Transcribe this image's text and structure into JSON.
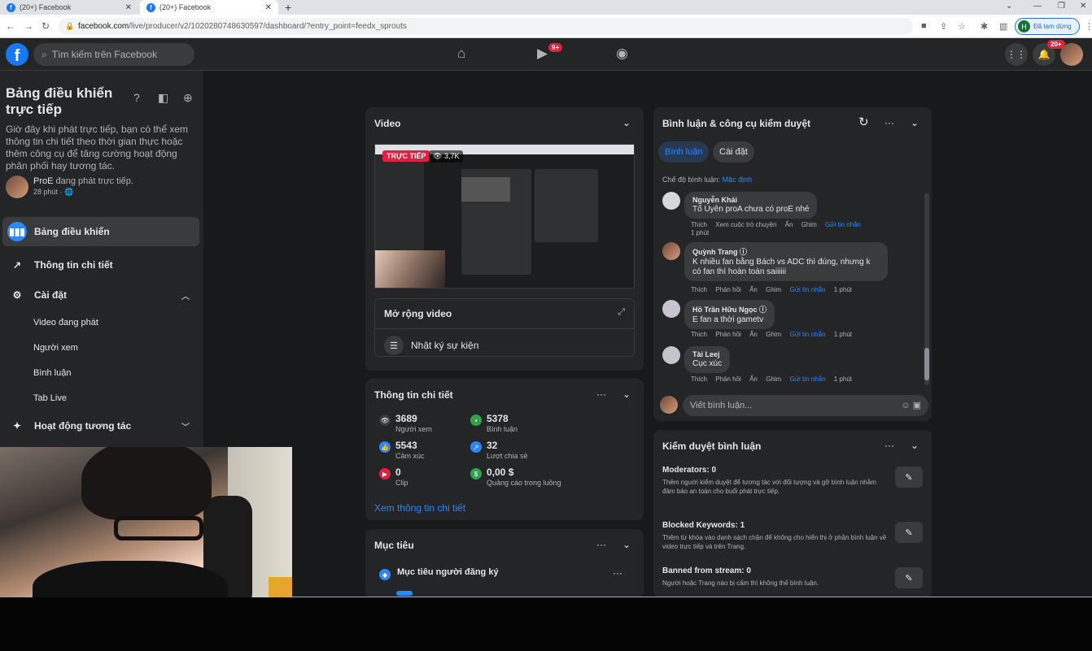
{
  "browser": {
    "tabs": [
      {
        "title": "(20+) Facebook"
      },
      {
        "title": "(20+) Facebook"
      }
    ],
    "url_host": "facebook.com",
    "url_path": "/live/producer/v2/1020280748630597/dashboard/?entry_point=feedx_sprouts",
    "profile_initial": "H",
    "profile_label": "Đã tạm dừng"
  },
  "topbar": {
    "search_placeholder": "Tìm kiếm trên Facebook",
    "video_badge": "9+",
    "notif_badge": "20+"
  },
  "sidebar": {
    "title": "Bảng điều khiển trực tiếp",
    "description": "Giờ đây khi phát trực tiếp, bạn có thể xem thông tin chi tiết theo thời gian thực hoặc thêm công cụ để tăng cường hoạt động phân phối hay tương tác.",
    "live_user_name": "ProE",
    "live_user_status": " đang phát trực tiếp.",
    "live_user_time": "28 phút · 🌐",
    "menu": [
      {
        "label": "Bảng điều khiển"
      },
      {
        "label": "Thông tin chi tiết"
      },
      {
        "label": "Cài đặt"
      },
      {
        "label": "Hoạt động tương tác"
      }
    ],
    "submenu": [
      "Video đang phát",
      "Người xem",
      "Bình luận",
      "Tab Live"
    ]
  },
  "video_card": {
    "title": "Video",
    "live_badge": "TRỰC TIẾP",
    "views": "3,7K",
    "expand_label": "Mở rộng video",
    "event_log_label": "Nhật ký sự kiện"
  },
  "insights_card": {
    "title": "Thông tin chi tiết",
    "stats": [
      {
        "value": "3689",
        "label": "Người xem"
      },
      {
        "value": "5378",
        "label": "Bình luận"
      },
      {
        "value": "5543",
        "label": "Cảm xúc"
      },
      {
        "value": "32",
        "label": "Lượt chia sẻ"
      },
      {
        "value": "0",
        "label": "Clip"
      },
      {
        "value": "0,00 $",
        "label": "Quảng cáo trong luồng"
      }
    ],
    "link": "Xem thông tin chi tiết"
  },
  "goals_card": {
    "title": "Mục tiêu",
    "item": "Mục tiêu người đăng ký"
  },
  "comments_card": {
    "title": "Bình luận & công cụ kiểm duyệt",
    "tab_comments": "Bình luận",
    "tab_settings": "Cài đặt",
    "mode_label": "Chế độ bình luận: ",
    "mode_value": "Mặc định",
    "comments": [
      {
        "name": "Nguyễn Khải",
        "text": "Tố Uyên proA chưa có proE nhé",
        "actions": [
          "Thích",
          "Xem cuộc trò chuyện",
          "Ẩn",
          "Ghim",
          "Gửi tin nhắn"
        ],
        "time": "1 phút"
      },
      {
        "name": "Quỳnh Trang",
        "text": "K nhiều fan bằng Bách vs ADC thì đúng, nhưng k có fan thì hoàn toàn saiiiiii",
        "actions": [
          "Thích",
          "Phản hồi",
          "Ẩn",
          "Ghim",
          "Gửi tin nhắn"
        ],
        "time": "1 phút"
      },
      {
        "name": "Hồ Trần Hữu Ngọc",
        "text": "E fan a thời gametv",
        "actions": [
          "Thích",
          "Phản hồi",
          "Ẩn",
          "Ghim",
          "Gửi tin nhắn"
        ],
        "time": "1 phút"
      },
      {
        "name": "Tài Leej",
        "text": "Cục xúc",
        "actions": [
          "Thích",
          "Phản hồi",
          "Ẩn",
          "Ghim",
          "Gửi tin nhắn"
        ],
        "time": "1 phút"
      }
    ],
    "write_placeholder": "Viết bình luận..."
  },
  "moderation_card": {
    "title": "Kiểm duyệt bình luận",
    "rows": [
      {
        "heading": "Moderators: 0",
        "desc": "Thêm người kiểm duyệt để tương tác với đối tượng và gỡ bình luận nhằm đảm bảo an toàn cho buổi phát trực tiếp."
      },
      {
        "heading": "Blocked Keywords: 1",
        "desc": "Thêm từ khóa vào danh sách chặn để không cho hiển thị ở phần bình luận về video trực tiếp và trên Trang."
      },
      {
        "heading": "Banned from stream: 0",
        "desc": "Người hoặc Trang nào bị cấm thì không thể bình luận."
      }
    ]
  },
  "colors": {
    "accent": "#2d88ff",
    "live": "#e41e3f",
    "bg": "#18191a",
    "card": "#242526"
  }
}
